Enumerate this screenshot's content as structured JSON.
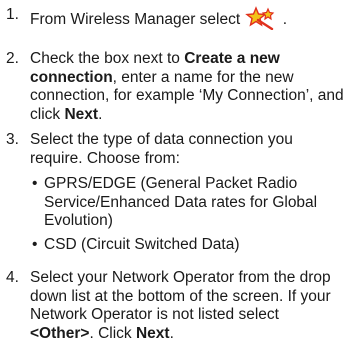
{
  "steps": [
    {
      "num": "1.",
      "text_before": "From Wireless Manager select",
      "icon": "connection-wizard-icon",
      "text_after": " ."
    },
    {
      "num": "2.",
      "t1": "Check the box next to ",
      "b1": "Create a new connection",
      "t2": ", enter a name for the new connection, for example ‘My Connection’, and click ",
      "b2": "Next",
      "t3": "."
    },
    {
      "num": "3.",
      "text": "Select the type of data connection you require. Choose from:",
      "bullets": [
        "GPRS/EDGE (General Packet Radio Service/Enhanced Data rates for Global Evolution)",
        "CSD (Circuit Switched Data)"
      ]
    },
    {
      "num": "4.",
      "t1": "Select your Network Operator from the drop down list at the bottom of the screen. If your Network Operator is not listed select ",
      "b1": "<Other>",
      "t2": ". Click ",
      "b2": "Next",
      "t3": "."
    }
  ],
  "colors": {
    "text": "#1a1a1a",
    "icon_red": "#e0301e",
    "icon_yellow": "#f2c318"
  }
}
